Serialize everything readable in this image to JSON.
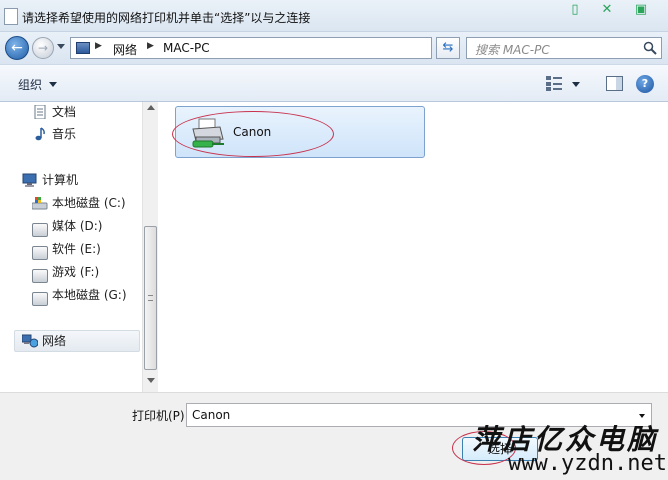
{
  "window": {
    "title": "请选择希望使用的网络打印机并单击“选择”以与之连接"
  },
  "address": {
    "crumbs": [
      "网络",
      "MAC-PC"
    ],
    "search_placeholder": "搜索 MAC-PC"
  },
  "toolbar": {
    "organize_label": "组织"
  },
  "nav": {
    "items": [
      {
        "label": "文档",
        "icon": "document-icon"
      },
      {
        "label": "音乐",
        "icon": "music-icon"
      },
      {
        "label": "计算机",
        "icon": "computer-icon"
      },
      {
        "label": "本地磁盘 (C:)",
        "icon": "system-drive-icon"
      },
      {
        "label": "媒体 (D:)",
        "icon": "drive-icon"
      },
      {
        "label": "软件 (E:)",
        "icon": "drive-icon"
      },
      {
        "label": "游戏 (F:)",
        "icon": "drive-icon"
      },
      {
        "label": "本地磁盘 (G:)",
        "icon": "drive-icon"
      },
      {
        "label": "网络",
        "icon": "network-icon",
        "selected": true
      }
    ]
  },
  "content": {
    "items": [
      {
        "name": "Canon",
        "icon": "printer-icon",
        "selected": true
      }
    ]
  },
  "bottom": {
    "printer_label": "打印机(P)",
    "printer_value": "Canon",
    "select_button": "选择"
  },
  "watermark": {
    "line1": "萍店亿众电脑",
    "line2": "www.yzdn.net"
  },
  "colors": {
    "selection_fill": "#cfe4fa",
    "annotation_oval": "#c8324d",
    "accent_blue": "#1f5ea8"
  }
}
